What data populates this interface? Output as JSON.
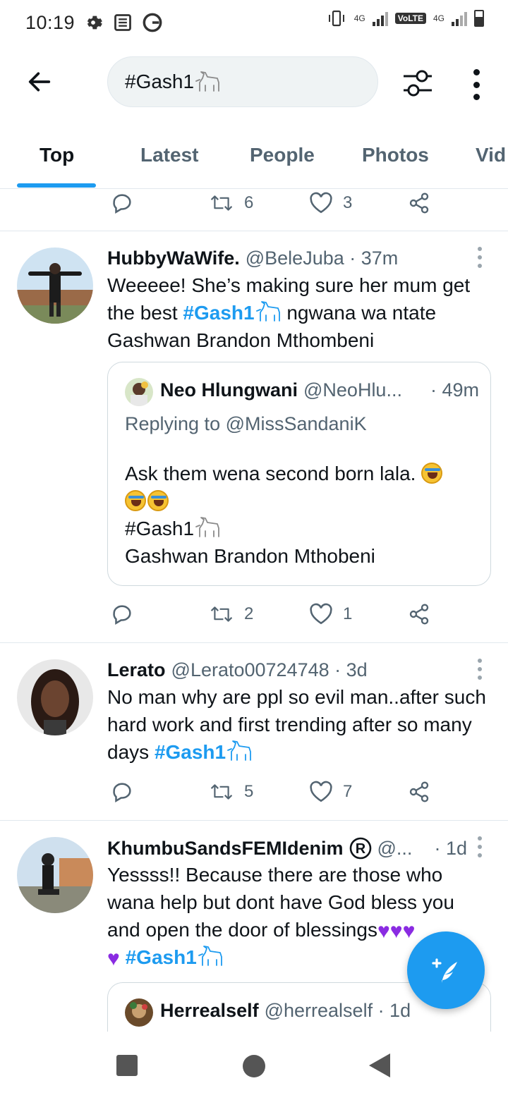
{
  "status_bar": {
    "time": "10:19",
    "network_1": "4G",
    "volte": "VoLTE",
    "network_2": "4G"
  },
  "search": {
    "query": "#Gash1"
  },
  "tabs": [
    {
      "label": "Top",
      "active": true
    },
    {
      "label": "Latest"
    },
    {
      "label": "People"
    },
    {
      "label": "Photos"
    },
    {
      "label": "Vid"
    }
  ],
  "top_actions": {
    "retweets": "6",
    "likes": "3"
  },
  "tweets": [
    {
      "name": "HubbyWaWife.",
      "handle": "@BeleJuba · 37m",
      "text_before": "Weeeee! She’s making sure her mum get the best ",
      "hashtag": "#Gash1",
      "text_after": " ngwana wa ntate Gashwan Brandon Mthombeni",
      "quote": {
        "name": "Neo Hlungwani",
        "handle": "@NeoHlu...",
        "time": "· 49m",
        "replying": "Replying to @MissSandaniK",
        "line1": "Ask them wena second born lala.",
        "line2": "#Gash1",
        "line3": "Gashwan Brandon Mthobeni"
      },
      "retweets": "2",
      "likes": "1"
    },
    {
      "name": "Lerato",
      "handle": "@Lerato00724748 · 3d",
      "text_before": "No man why are ppl so evil man..after such hard work and first trending after so many days ",
      "hashtag": "#Gash1",
      "retweets": "5",
      "likes": "7"
    },
    {
      "name": "KhumbuSandsFEMIdenim",
      "handle": "@...",
      "time": "· 1d",
      "text_before": "Yessss!! Because there are those who wana help but dont have God bless you and open the door of blessings",
      "hashtag": "#Gash1",
      "quote": {
        "name": "Herrealself",
        "handle": "@herrealself · 1d"
      }
    }
  ],
  "colors": {
    "accent": "#1d9bf0",
    "text": "#0f1419",
    "muted": "#536471"
  }
}
